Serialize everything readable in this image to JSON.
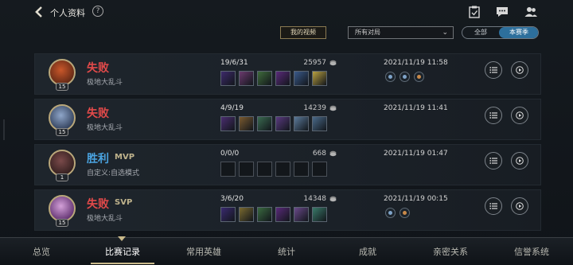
{
  "header": {
    "title": "个人资料",
    "help_label": "?",
    "icons": [
      "back-chevron-icon",
      "clipboard-check-icon",
      "chat-icon",
      "friends-icon"
    ]
  },
  "filters": {
    "my_video": "我的视频",
    "mode_select": "所有对局",
    "segment": {
      "all": "全部",
      "season": "本赛季",
      "selected": "本赛季"
    }
  },
  "matches": [
    {
      "level": "15",
      "result": "失败",
      "result_type": "loss",
      "badge": "",
      "mode": "极地大乱斗",
      "kda": "19/6/31",
      "gold": "25957",
      "date": "2021/11/19 11:58",
      "item_colors": [
        "#3d2a6b",
        "#6b3a6e",
        "#3f6b3b",
        "#5a2a7a",
        "#3a5a8a",
        "#b8a040"
      ],
      "rune_icons": [
        "inspiration-rune-icon",
        "resolve-rune-icon",
        "domination-rune-icon"
      ]
    },
    {
      "level": "15",
      "result": "失败",
      "result_type": "loss",
      "badge": "",
      "mode": "极地大乱斗",
      "kda": "4/9/19",
      "gold": "14239",
      "date": "2021/11/19 11:41",
      "item_colors": [
        "#4a2d70",
        "#7a5a30",
        "#3a6a50",
        "#5a3a80",
        "#5b7a9a",
        "#4a6a8a"
      ],
      "rune_icons": []
    },
    {
      "level": "1",
      "result": "胜利",
      "result_type": "win",
      "badge": "MVP",
      "mode": "自定义:自选模式",
      "kda": "0/0/0",
      "gold": "668",
      "date": "2021/11/19 01:47",
      "item_colors": [],
      "rune_icons": []
    },
    {
      "level": "15",
      "result": "失败",
      "result_type": "loss",
      "badge": "SVP",
      "mode": "极地大乱斗",
      "kda": "3/6/20",
      "gold": "14348",
      "date": "2021/11/19 00:15",
      "item_colors": [
        "#3a2a70",
        "#7a6a30",
        "#3a6a40",
        "#5a2a7a",
        "#6a4a8a",
        "#3a7a6a"
      ],
      "rune_icons": [
        "inspiration-rune-icon",
        "domination-rune-icon"
      ]
    }
  ],
  "nav": {
    "tabs": [
      "总览",
      "比赛记录",
      "常用英雄",
      "统计",
      "成就",
      "亲密关系",
      "信誉系统"
    ],
    "active": "比赛记录"
  },
  "colors": {
    "loss": "#e24a4a",
    "win": "#4aa3e0",
    "accent_blue": "#2d6f9c",
    "gold_accent": "#c9b98a"
  }
}
